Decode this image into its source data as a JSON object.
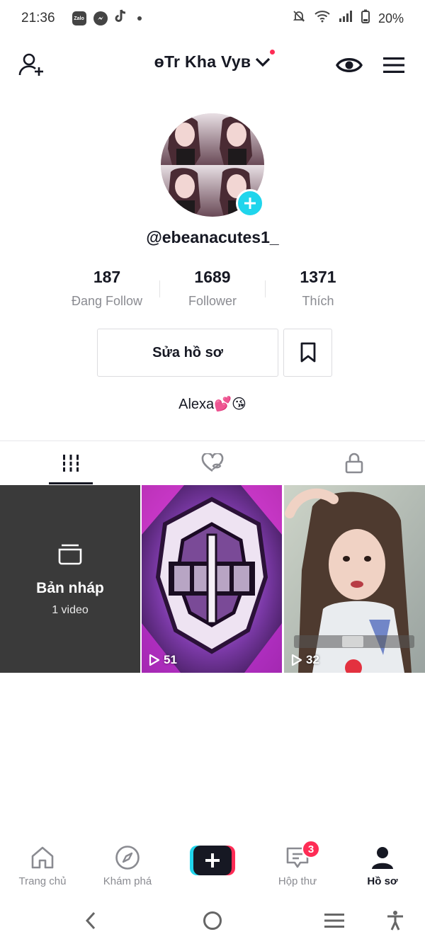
{
  "status_bar": {
    "time": "21:36",
    "battery": "20%",
    "app_icons": [
      "zalo-icon",
      "messenger-icon",
      "tiktok-icon"
    ],
    "zalo_label": "Zalo"
  },
  "header": {
    "title": "ɵTr Kha Vyв",
    "icons": [
      "add-user-icon",
      "eye-icon",
      "menu-icon",
      "chevron-down-icon"
    ]
  },
  "profile": {
    "username": "@ebeanacutes1_",
    "stats": [
      {
        "value": "187",
        "label": "Đang Follow"
      },
      {
        "value": "1689",
        "label": "Follower"
      },
      {
        "value": "1371",
        "label": "Thích"
      }
    ],
    "edit_button": "Sửa hồ sơ",
    "bio": "Alexa💕😘"
  },
  "tabs": [
    {
      "name": "videos",
      "icon": "grid-icon",
      "active": true
    },
    {
      "name": "liked",
      "icon": "hidden-heart-icon",
      "active": false
    },
    {
      "name": "private",
      "icon": "lock-icon",
      "active": false
    }
  ],
  "grid": {
    "draft": {
      "title": "Bản nháp",
      "subtitle": "1 video"
    },
    "videos": [
      {
        "plays": "51"
      },
      {
        "plays": "32"
      }
    ]
  },
  "bottom_nav": [
    {
      "label": "Trang chủ",
      "icon": "home-icon"
    },
    {
      "label": "Khám phá",
      "icon": "compass-icon"
    },
    {
      "label": "",
      "icon": "create-icon"
    },
    {
      "label": "Hộp thư",
      "icon": "inbox-icon",
      "badge": "3"
    },
    {
      "label": "Hồ sơ",
      "icon": "profile-icon",
      "active": true
    }
  ],
  "colors": {
    "accent_red": "#fe2c55",
    "accent_cyan": "#20d5ec",
    "text_primary": "#161823",
    "text_secondary": "#8a8b91"
  }
}
